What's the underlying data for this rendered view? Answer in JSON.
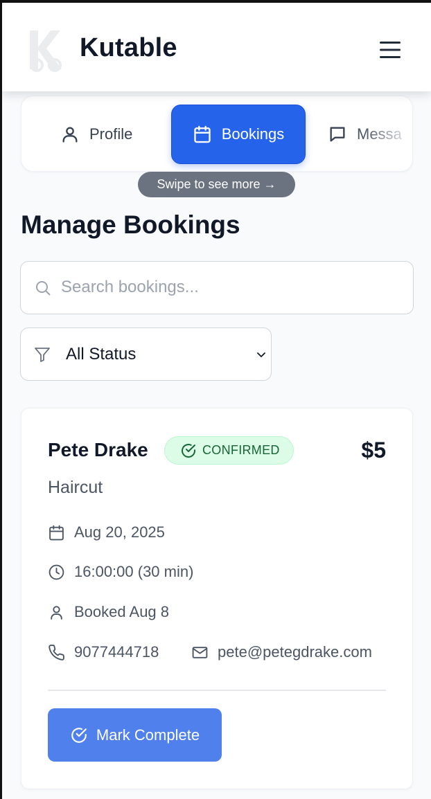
{
  "app": {
    "brand": "Kutable",
    "logo_icon": "scissors-k-logo-icon",
    "menu_icon": "hamburger-menu-icon"
  },
  "tabs": [
    {
      "label": "Profile",
      "icon": "user-icon",
      "active": false
    },
    {
      "label": "Bookings",
      "icon": "calendar-icon",
      "active": true
    },
    {
      "label": "Messa",
      "icon": "message-icon",
      "active": false
    }
  ],
  "swipe_hint": "Swipe to see more →",
  "page_title": "Manage Bookings",
  "search": {
    "placeholder": "Search bookings...",
    "value": ""
  },
  "status_filter": {
    "selected": "All Status"
  },
  "booking": {
    "client_name": "Pete Drake",
    "status": "CONFIRMED",
    "price": "$5",
    "service": "Haircut",
    "date": "Aug 20, 2025",
    "time": "16:00:00 (30 min)",
    "booked": "Booked Aug 8",
    "phone": "9077444718",
    "email": "pete@petegdrake.com",
    "action_label": "Mark Complete"
  },
  "colors": {
    "primary": "#2563eb",
    "action_button": "#4f80ec",
    "confirmed_bg": "#dcfce7",
    "confirmed_text": "#166534",
    "swipe_hint_bg": "#6b7280"
  }
}
